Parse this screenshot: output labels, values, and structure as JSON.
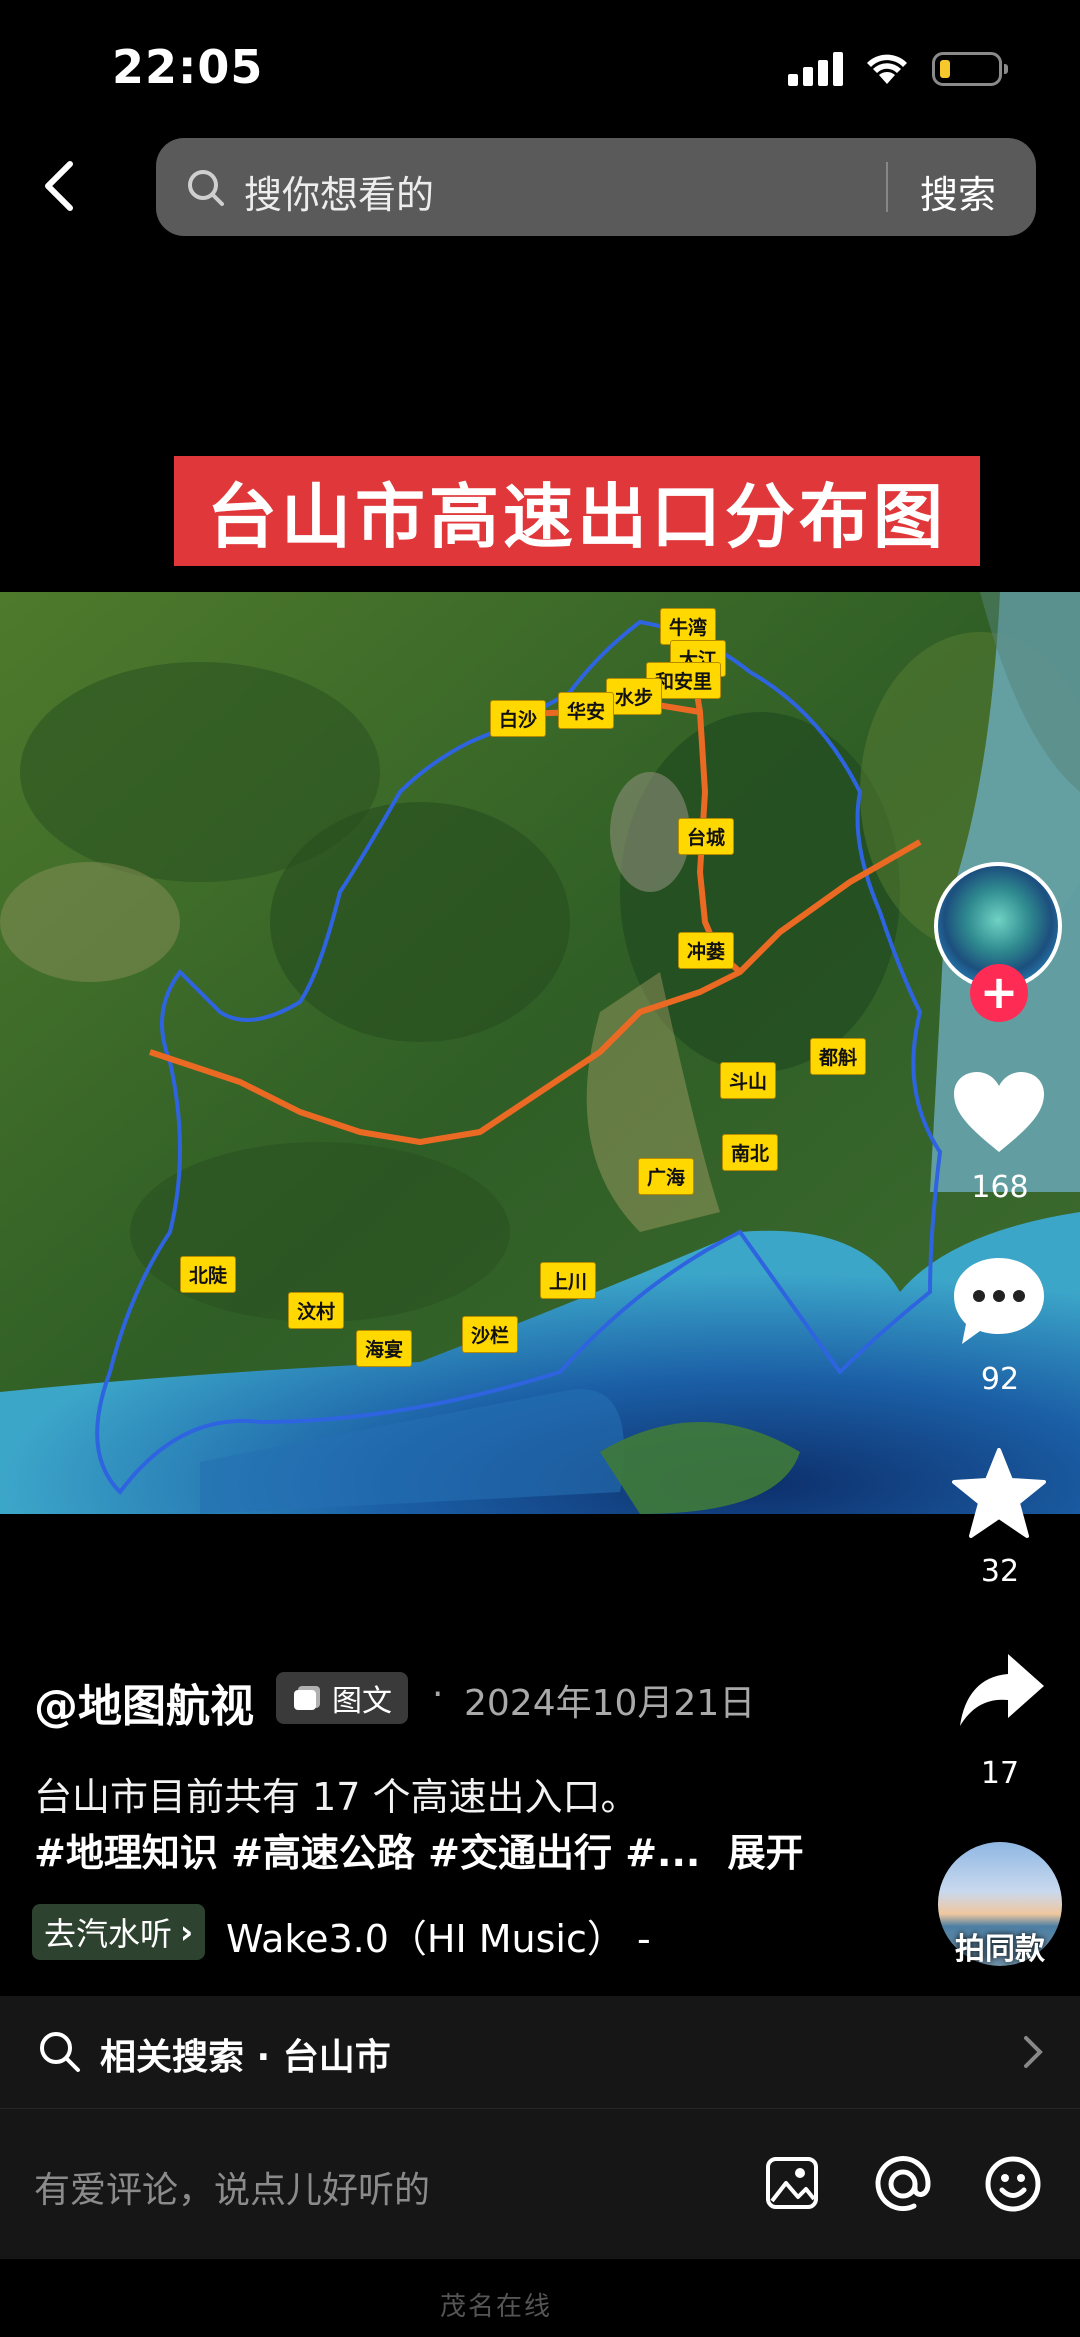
{
  "status_bar": {
    "time": "22:05"
  },
  "search": {
    "placeholder": "搜你想看的",
    "button": "搜索"
  },
  "post_image": {
    "title": "台山市高速出口分布图",
    "exits": [
      "牛湾",
      "大江",
      "和安里",
      "水步",
      "华安",
      "白沙",
      "台城",
      "冲蒌",
      "斗山",
      "都斛",
      "南北",
      "广海",
      "上川",
      "沙栏",
      "海宴",
      "汶村",
      "北陡"
    ]
  },
  "actions": {
    "likes": "168",
    "comments": "92",
    "favorites": "32",
    "shares": "17",
    "same_style": "拍同款"
  },
  "post": {
    "author": "@地图航视",
    "type_badge": "图文",
    "date": "2024年10月21日",
    "caption_line1": "台山市目前共有 17 个高速出入口。",
    "caption_line2": "#地理知识 #高速公路 #交通出行 #...",
    "expand": "展开",
    "music_tag": "去汽水听",
    "music": "Wake3.0（HI Music） -"
  },
  "related": {
    "label": "相关搜索 · 台山市"
  },
  "comment": {
    "placeholder": "有爱评论，说点儿好听的"
  },
  "watermark": "茂名在线"
}
